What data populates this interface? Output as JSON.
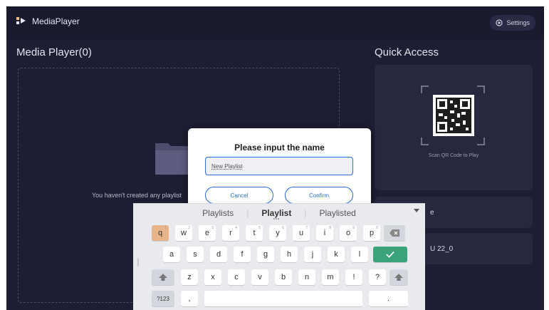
{
  "app": {
    "title": "MediaPlayer"
  },
  "header": {
    "settings_label": "Settings",
    "settings_icon": "gear-icon"
  },
  "main": {
    "title": "Media Player(0)",
    "empty_message": "You haven't created any playlist"
  },
  "quick_access": {
    "title": "Quick Access",
    "qr_caption": "Scan QR Code to Play",
    "items": [
      {
        "label": "e"
      },
      {
        "label": "U 22_0"
      }
    ]
  },
  "dialog": {
    "title": "Please input the name",
    "input_value": "New Playlist",
    "cancel_label": "Cancel",
    "confirm_label": "Confirm"
  },
  "keyboard": {
    "suggestions": [
      "Playlists",
      "Playlist",
      "Playlisted"
    ],
    "row1": [
      "q",
      "w",
      "e",
      "r",
      "t",
      "y",
      "u",
      "i",
      "o",
      "p"
    ],
    "row1_hints": [
      "1",
      "2",
      "3",
      "4",
      "5",
      "6",
      "7",
      "8",
      "9",
      "0"
    ],
    "row2": [
      "a",
      "s",
      "d",
      "f",
      "g",
      "h",
      "j",
      "k",
      "l"
    ],
    "row3": [
      "z",
      "x",
      "c",
      "v",
      "b",
      "n",
      "m",
      "!",
      "?"
    ],
    "symbols_label": "?123",
    "comma": ",",
    "period": "."
  },
  "colors": {
    "background": "#1d1d33",
    "panel": "#27273f",
    "accent": "#2f6fd6",
    "enter_key": "#3aa37a",
    "active_key": "#e8b48a"
  }
}
